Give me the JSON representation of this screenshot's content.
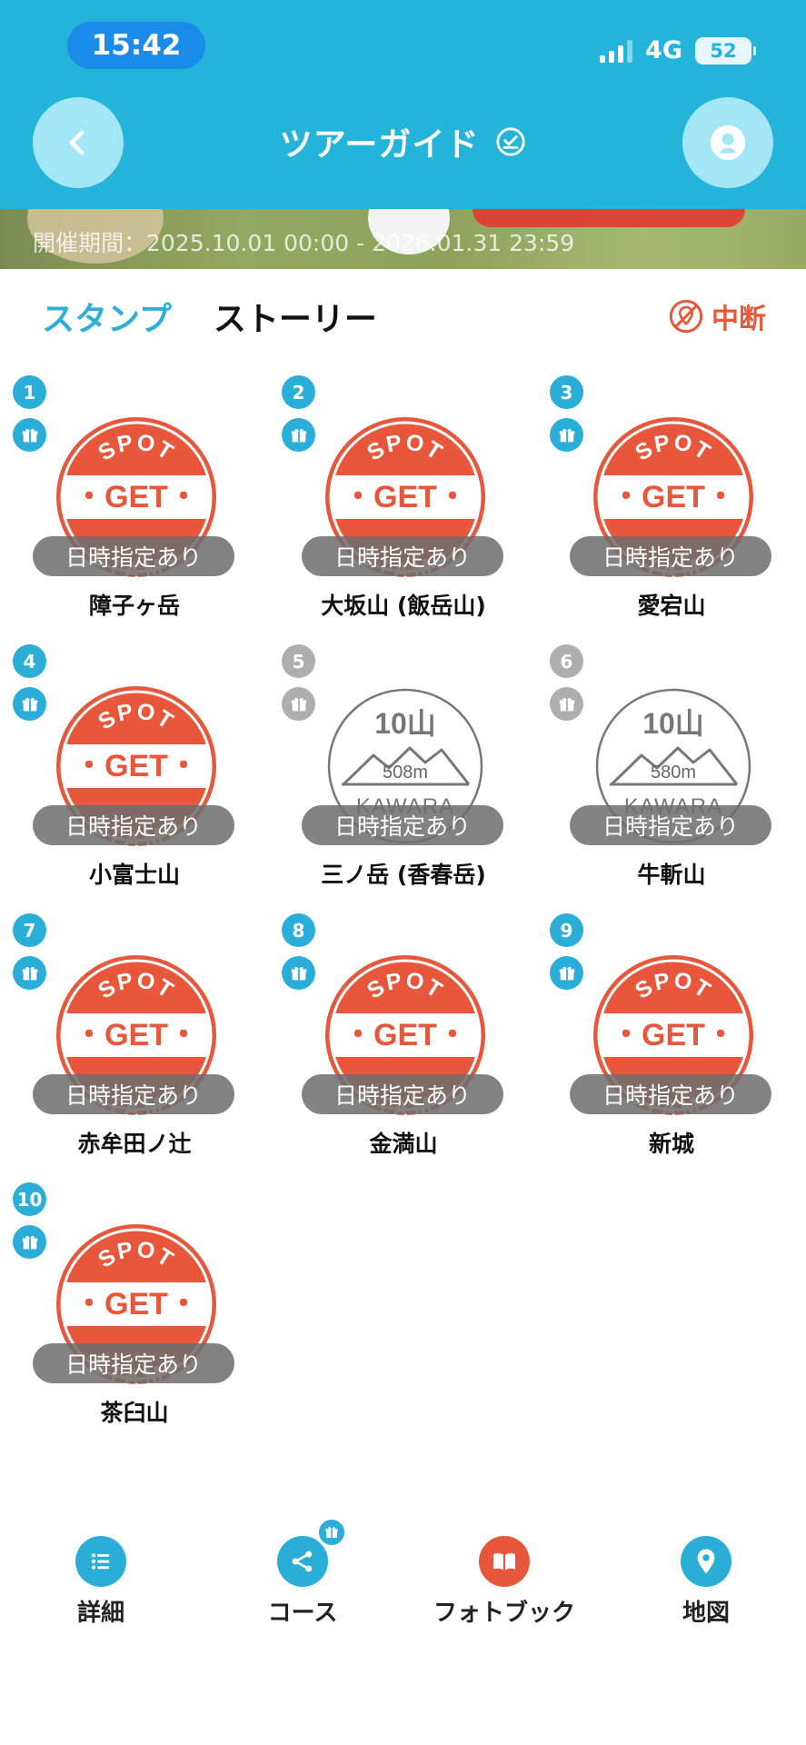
{
  "status_bar": {
    "time": "15:42",
    "network": "4G",
    "battery": "52"
  },
  "header": {
    "title": "ツアーガイド"
  },
  "banner": {
    "period": "開催期間：2025.10.01 00:00 - 2026.01.31 23:59"
  },
  "tabs": [
    {
      "label": "スタンプ",
      "active": true
    },
    {
      "label": "ストーリー",
      "active": false
    }
  ],
  "suspend_label": "中断",
  "colors": {
    "header": "#24b3d9",
    "stamp_red": "#e8573b",
    "inactive": "#aeaeae",
    "suspend": "#e45a3b"
  },
  "stamp_text": {
    "top": "SPOT",
    "middle": "・GET・",
    "bottom": "STAMP"
  },
  "spots": [
    {
      "num": "1",
      "name": "障子ヶ岳",
      "status": "日時指定あり",
      "acquired": true
    },
    {
      "num": "2",
      "name": "大坂山 (飯岳山)",
      "status": "日時指定あり",
      "acquired": true
    },
    {
      "num": "3",
      "name": "愛宕山",
      "status": "日時指定あり",
      "acquired": true
    },
    {
      "num": "4",
      "name": "小富士山",
      "status": "日時指定あり",
      "acquired": true
    },
    {
      "num": "5",
      "name": "三ノ岳 (香春岳)",
      "status": "日時指定あり",
      "acquired": false,
      "stamp_title": "10山",
      "elevation": "508m",
      "brand": "KAWARA"
    },
    {
      "num": "6",
      "name": "牛斬山",
      "status": "日時指定あり",
      "acquired": false,
      "stamp_title": "10山",
      "elevation": "580m",
      "brand": "KAWARA"
    },
    {
      "num": "7",
      "name": "赤牟田ノ辻",
      "status": "日時指定あり",
      "acquired": true
    },
    {
      "num": "8",
      "name": "金満山",
      "status": "日時指定あり",
      "acquired": true
    },
    {
      "num": "9",
      "name": "新城",
      "status": "日時指定あり",
      "acquired": true
    },
    {
      "num": "10",
      "name": "茶臼山",
      "status": "日時指定あり",
      "acquired": true
    }
  ],
  "bottom_nav": [
    {
      "label": "詳細",
      "icon": "list-icon"
    },
    {
      "label": "コース",
      "icon": "route-icon"
    },
    {
      "label": "フォトブック",
      "icon": "book-icon"
    },
    {
      "label": "地図",
      "icon": "map-pin-icon"
    }
  ]
}
